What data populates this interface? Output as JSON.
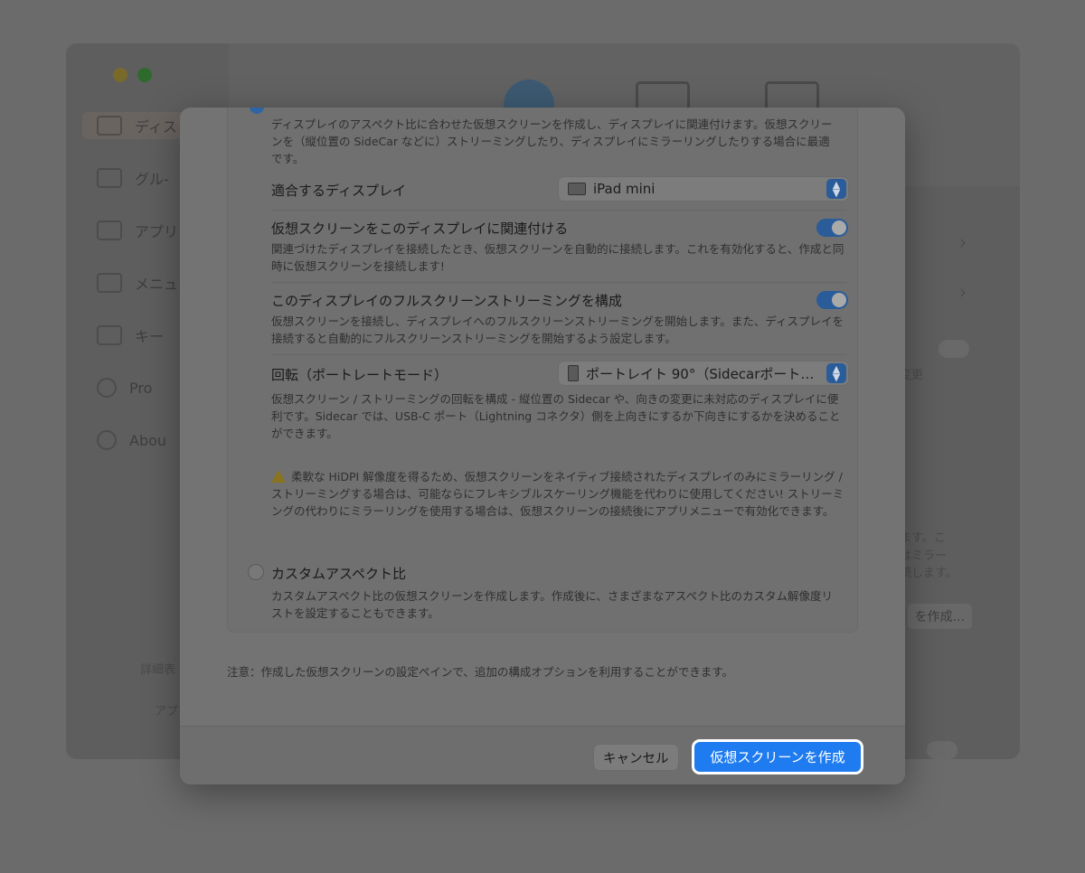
{
  "background": {
    "sidebar_items": [
      {
        "label": "ディス"
      },
      {
        "label": "グル-"
      },
      {
        "label": "アプリ"
      },
      {
        "label": "メニュ"
      },
      {
        "label": "キー"
      },
      {
        "label": "Pro"
      },
      {
        "label": "Abou"
      }
    ],
    "bottom_fragments": [
      "詳細表",
      "アプ"
    ],
    "right_fragments": [
      "変更",
      "ます。こ",
      "はミラー",
      "続します。"
    ],
    "create_button_fragment": "を作成..."
  },
  "dialog": {
    "top_option": {
      "description": "ディスプレイのアスペクト比に合わせた仮想スクリーンを作成し、ディスプレイに関連付けます。仮想スクリーンを（縦位置の SideCar などに）ストリーミングしたり、ディスプレイにミラーリングしたりする場合に最適です。",
      "display_label": "適合するディスプレイ",
      "display_value": "iPad mini",
      "associate": {
        "label": "仮想スクリーンをこのディスプレイに関連付ける",
        "enabled": true,
        "description": "関連づけたディスプレイを接続したとき、仮想スクリーンを自動的に接続します。これを有効化すると、作成と同時に仮想スクリーンを接続します!"
      },
      "fullscreen": {
        "label": "このディスプレイのフルスクリーンストリーミングを構成",
        "enabled": true,
        "description": "仮想スクリーンを接続し、ディスプレイへのフルスクリーンストリーミングを開始します。また、ディスプレイを接続すると自動的にフルスクリーンストリーミングを開始するよう設定します。"
      },
      "rotation": {
        "label": "回転（ポートレートモード）",
        "value": "ポートレイト 90°（Sidecarポート…",
        "description": "仮想スクリーン / ストリーミングの回転を構成 - 縦位置の Sidecar や、向きの変更に未対応のディスプレイに便利です。Sidecar では、USB-C ポート（Lightning コネクタ）側を上向きにするか下向きにするかを決めることができます。"
      },
      "warning": "柔軟な HiDPI 解像度を得るため、仮想スクリーンをネイティブ接続されたディスプレイのみにミラーリング / ストリーミングする場合は、可能ならにフレキシブルスケーリング機能を代わりに使用してください! ストリーミングの代わりにミラーリングを使用する場合は、仮想スクリーンの接続後にアプリメニューで有効化できます。"
    },
    "custom_option": {
      "label": "カスタムアスペクト比",
      "description": "カスタムアスペクト比の仮想スクリーンを作成します。作成後に、さまざまなアスペクト比のカスタム解像度リストを設定することもできます。"
    },
    "note": "注意：作成した仮想スクリーンの設定ペインで、追加の構成オプションを利用することができます。",
    "cancel_label": "キャンセル",
    "create_label": "仮想スクリーンを作成"
  },
  "colors": {
    "accent": "#1f7cf0",
    "toggle_on": "#2a5c9a",
    "dim_overlay": "#6b6b6b"
  }
}
